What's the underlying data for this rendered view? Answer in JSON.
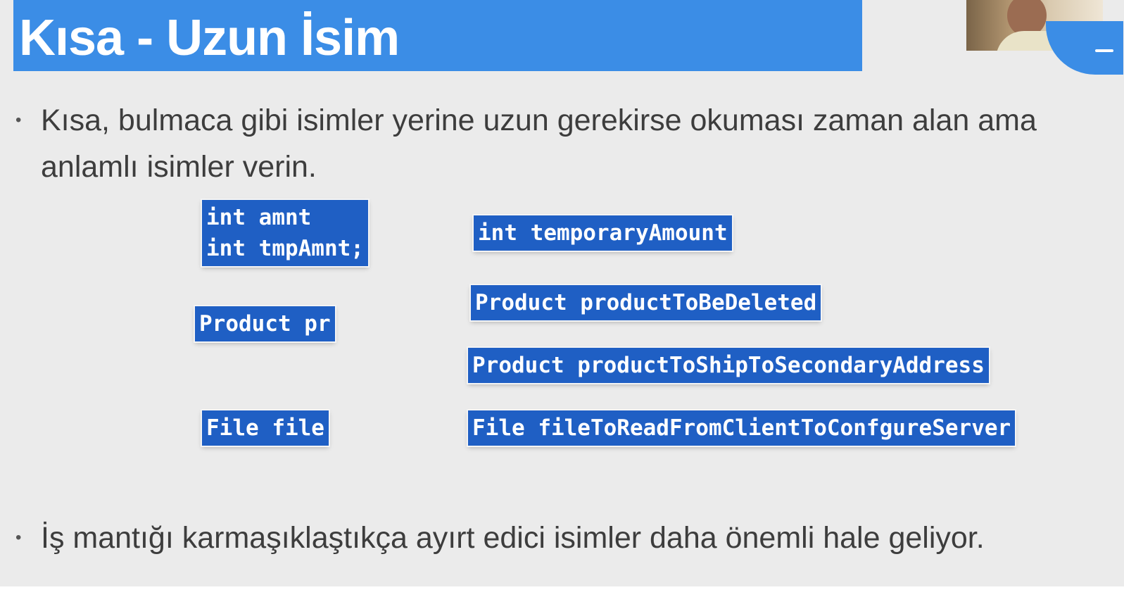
{
  "title": "Kısa - Uzun İsim",
  "bullets": [
    {
      "dot": "•",
      "text": "Kısa, bulmaca gibi isimler yerine uzun gerekirse okuması zaman alan ama anlamlı isimler verin."
    },
    {
      "dot": "•",
      "text": "İş mantığı karmaşıklaştıkça ayırt edici isimler daha önemli hale geliyor."
    }
  ],
  "short_names": [
    "int amnt\nint tmpAmnt;",
    "Product pr",
    "File file"
  ],
  "long_names": [
    "int temporaryAmount",
    "Product productToBeDeleted",
    "Product productToShipToSecondaryAddress",
    "File fileToReadFromClientToConfgureServer"
  ],
  "colors": {
    "title_bar": "#3b8de6",
    "code_box": "#1f5fc4",
    "slide_bg": "#ebebeb"
  }
}
